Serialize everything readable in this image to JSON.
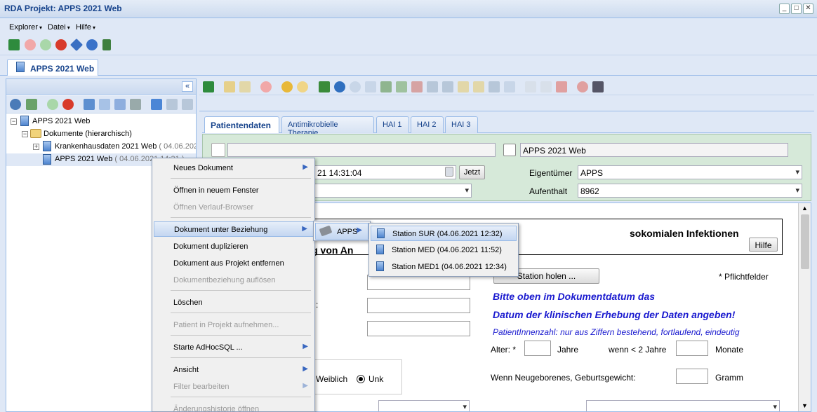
{
  "window": {
    "title": "RDA Projekt: APPS 2021 Web"
  },
  "menubar": {
    "items": [
      "Explorer",
      "Datei",
      "Hilfe"
    ]
  },
  "app_tab": {
    "label": "APPS 2021 Web"
  },
  "left_panel": {
    "collapse_glyph": "«"
  },
  "tree": {
    "root": "APPS 2021 Web",
    "folder": "Dokumente (hierarchisch)",
    "doc1_name": "Krankenhausdaten 2021 Web",
    "doc1_date": "( 04.06.202",
    "doc2_name": "APPS 2021 Web",
    "doc2_date": "( 04.06.2021 14:31 )"
  },
  "patient_tabs": [
    "Patientendaten",
    "Antimikrobielle Therapie",
    "HAI 1",
    "HAI 2",
    "HAI 3"
  ],
  "header": {
    "project_field": "APPS 2021 Web",
    "datetime_value": "21 14:31:04",
    "jetzt_button": "Jetzt",
    "owner_label": "Eigentümer",
    "owner_value": "APPS",
    "stay_label": "Aufenthalt",
    "stay_value": "8962"
  },
  "form": {
    "title_right": "sokomialen Infektionen",
    "title_left": "ung von An",
    "help_button": "Hilfe",
    "station_button": "Station holen ...",
    "required_note": "* Pflichtfelder",
    "blue_line1": "Bitte oben im Dokumentdatum das",
    "blue_line2": "Datum der klinischen Erhebung der Daten angeben!",
    "patient_note": "PatientInnenzahl: nur aus Ziffern bestehend, fortlaufend, eindeutig",
    "age_label": "Alter: *",
    "years_label": "Jahre",
    "under2_label": "wenn < 2 Jahre",
    "months_label": "Monate",
    "newborn_label": "Wenn Neugeborenes, Geburtsgewicht:",
    "gram_label": "Gramm",
    "sex_female": "Weiblich",
    "sex_unknown": "Unk",
    "colon_fragment": ":"
  },
  "context_menu": {
    "items": [
      {
        "label": "Neues Dokument",
        "enabled": true,
        "submenu": true
      },
      {
        "label": "Öffnen in neuem Fenster",
        "enabled": true,
        "submenu": false
      },
      {
        "label": "Öffnen Verlauf-Browser",
        "enabled": false,
        "submenu": false
      },
      {
        "label": "Dokument unter Beziehung",
        "enabled": true,
        "submenu": true,
        "highlighted": true
      },
      {
        "label": "Dokument duplizieren",
        "enabled": true,
        "submenu": false
      },
      {
        "label": "Dokument aus Projekt entfernen",
        "enabled": true,
        "submenu": false
      },
      {
        "label": "Dokumentbeziehung auflösen",
        "enabled": false,
        "submenu": false
      },
      {
        "label": "Löschen",
        "enabled": true,
        "submenu": false
      },
      {
        "label": "Patient in Projekt aufnehmen...",
        "enabled": false,
        "submenu": false
      },
      {
        "label": "Starte AdHocSQL ...",
        "enabled": true,
        "submenu": true
      },
      {
        "label": "Ansicht",
        "enabled": true,
        "submenu": true
      },
      {
        "label": "Filter bearbeiten",
        "enabled": false,
        "submenu": true
      },
      {
        "label": "Änderungshistorie öffnen",
        "enabled": false,
        "submenu": false
      }
    ]
  },
  "submenu_apps": {
    "label": "APPS"
  },
  "submenu_stations": [
    "Station SUR (04.06.2021 12:32)",
    "Station MED (04.06.2021 11:52)",
    "Station MED1 (04.06.2021 12:34)"
  ]
}
